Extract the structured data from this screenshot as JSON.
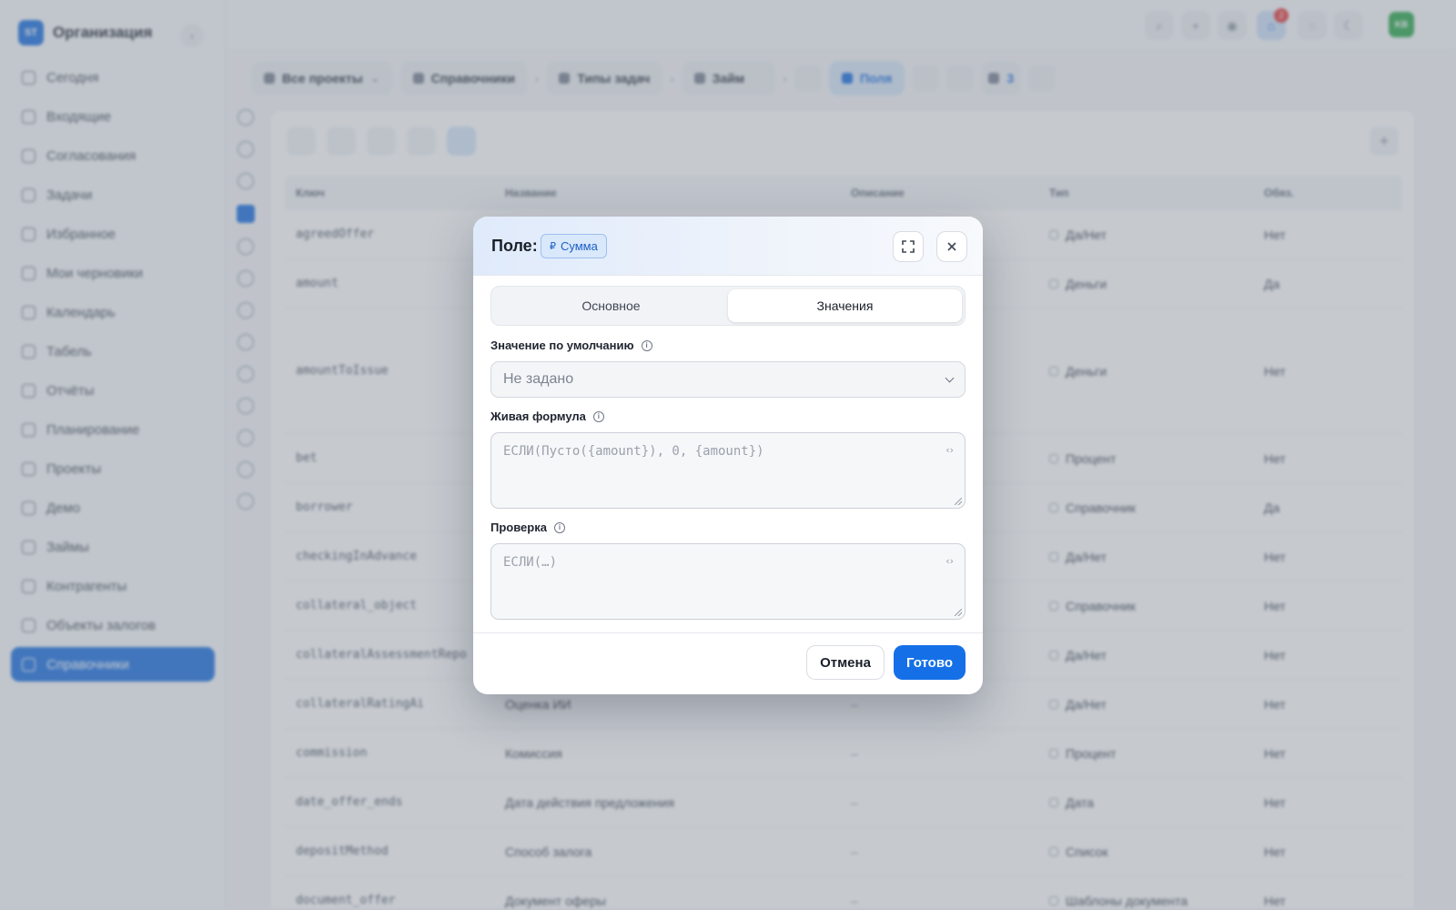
{
  "org": {
    "logo": "ST",
    "name": "Организация",
    "collapse_icon": "‹"
  },
  "nav": [
    {
      "label": "Сегодня",
      "icon": "home-icon"
    },
    {
      "label": "Входящие",
      "icon": "inbox-icon"
    },
    {
      "label": "Согласования",
      "icon": "approval-icon"
    },
    {
      "label": "Задачи",
      "icon": "tasks-icon"
    },
    {
      "label": "Избранное",
      "icon": "star-icon"
    },
    {
      "label": "Мои черновики",
      "icon": "draft-icon"
    },
    {
      "label": "Календарь",
      "icon": "calendar-icon"
    },
    {
      "label": "Табель",
      "icon": "timesheet-icon"
    },
    {
      "label": "Отчёты",
      "icon": "reports-icon"
    },
    {
      "label": "Планирование",
      "icon": "flag-icon"
    },
    {
      "label": "Проекты",
      "icon": "projects-icon"
    },
    {
      "label": "Демо",
      "icon": "demo-icon"
    },
    {
      "label": "Займы",
      "icon": "loans-icon"
    },
    {
      "label": "Контрагенты",
      "icon": "contractors-icon"
    },
    {
      "label": "Объекты залогов",
      "icon": "collateral-icon"
    },
    {
      "label": "Справочники",
      "icon": "directory-icon",
      "active": true
    }
  ],
  "topbar": {
    "notification_count": "2",
    "avatar": "KB"
  },
  "breadcrumbs": [
    "Все проекты",
    "Справочники",
    "Типы задач",
    "Займ",
    "Поля"
  ],
  "crumb_badge": "3",
  "table": {
    "headers": [
      "Ключ",
      "Название",
      "Описание",
      "Тип",
      "Обяз."
    ],
    "rows": [
      {
        "key": "agreedOffer",
        "name": "",
        "desc": "",
        "type": "Да/Нет",
        "req": "Нет"
      },
      {
        "key": "amount",
        "name": "",
        "desc": "",
        "type": "Деньги",
        "req": "Да"
      },
      {
        "key": "amountToIssue",
        "name": "",
        "desc": "",
        "type": "Деньги",
        "req": "Нет"
      },
      {
        "key": "bet",
        "name": "",
        "desc": "",
        "type": "Процент",
        "req": "Нет"
      },
      {
        "key": "borrower",
        "name": "",
        "desc": "",
        "type": "Справочник",
        "req": "Да"
      },
      {
        "key": "checkingInAdvance",
        "name": "",
        "desc": "",
        "type": "Да/Нет",
        "req": "Нет"
      },
      {
        "key": "collateral_object",
        "name": "",
        "desc": "",
        "type": "Справочник",
        "req": "Нет"
      },
      {
        "key": "collateralAssessmentRepo",
        "name": "",
        "desc": "",
        "type": "Да/Нет",
        "req": "Нет"
      },
      {
        "key": "collateralRatingAi",
        "name": "Оценка ИИ",
        "desc": "–",
        "type": "Да/Нет",
        "req": "Нет"
      },
      {
        "key": "commission",
        "name": "Комиссия",
        "desc": "–",
        "type": "Процент",
        "req": "Нет"
      },
      {
        "key": "date_offer_ends",
        "name": "Дата действия предложения",
        "desc": "–",
        "type": "Дата",
        "req": "Нет"
      },
      {
        "key": "depositMethod",
        "name": "Способ залога",
        "desc": "–",
        "type": "Список",
        "req": "Нет"
      },
      {
        "key": "document_offer",
        "name": "Документ оферы",
        "desc": "–",
        "type": "Шаблоны документа",
        "req": "Нет"
      }
    ]
  },
  "modal": {
    "title": "Поле:",
    "field_chip": {
      "symbol": "₽",
      "label": "Сумма"
    },
    "tabs": [
      {
        "label": "Основное",
        "active": false
      },
      {
        "label": "Значения",
        "active": true
      }
    ],
    "default_value": {
      "label": "Значение по умолчанию",
      "value": "Не задано"
    },
    "live_formula": {
      "label": "Живая формула",
      "placeholder": "ЕСЛИ(Пусто({amount}), 0, {amount})"
    },
    "validation": {
      "label": "Проверка",
      "placeholder": "ЕСЛИ(…)"
    },
    "cancel_label": "Отмена",
    "done_label": "Готово"
  },
  "colors": {
    "accent": "#1570e8",
    "sidebar_active": "#1b6fe0",
    "badge": "#e23b3b",
    "avatar": "#2ea84d"
  }
}
